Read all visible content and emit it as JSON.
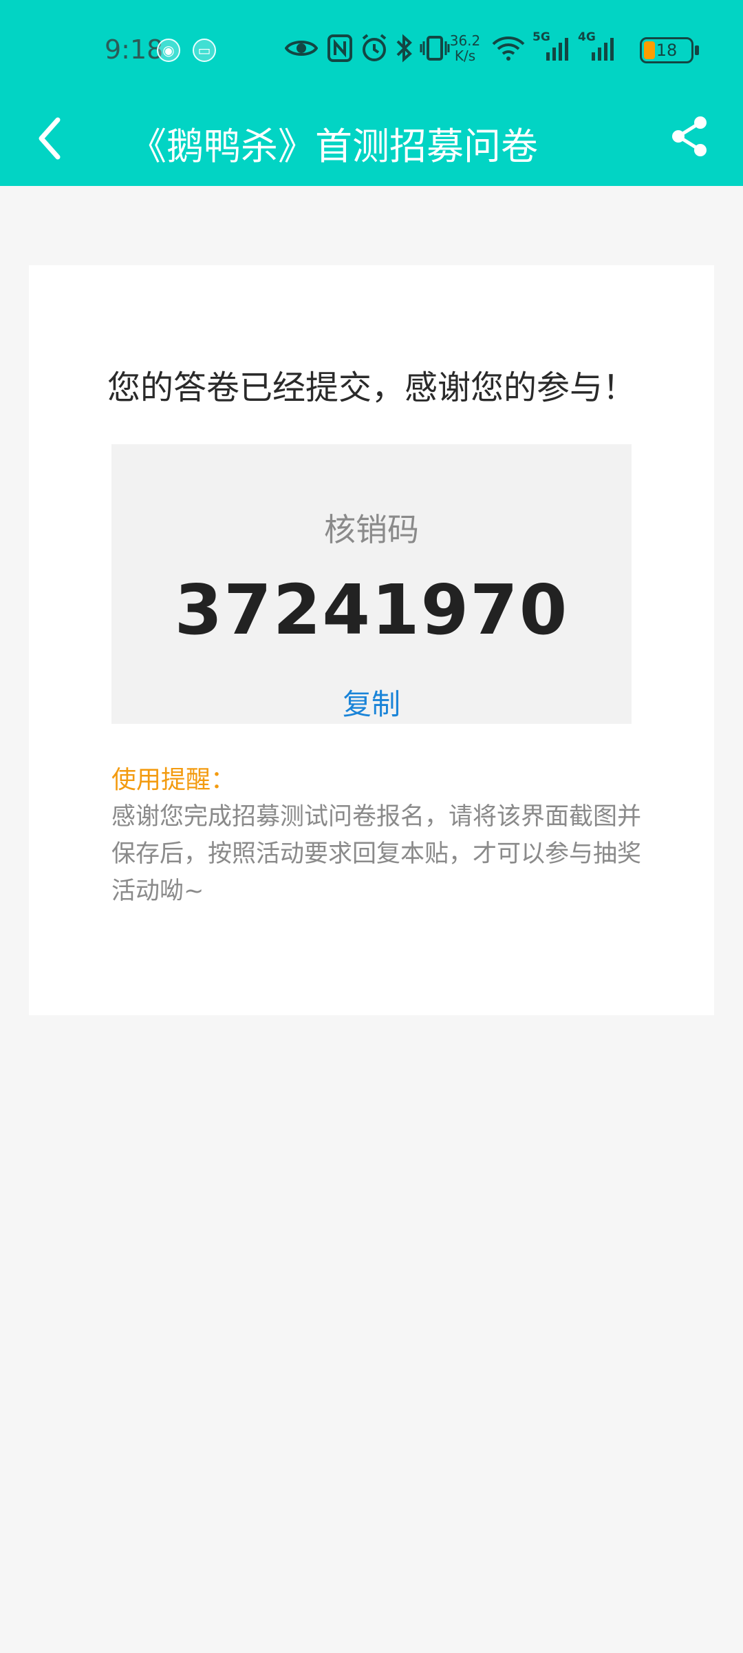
{
  "status_bar": {
    "time": "9:18",
    "notif_icons": [
      "wechat-icon",
      "message-icon"
    ],
    "network_speed_value": "36.2",
    "network_speed_unit": "K/s",
    "net1": "5G",
    "net2": "4G",
    "battery_level": "18"
  },
  "header": {
    "title": "《鹅鸭杀》首测招募问卷",
    "back_icon": "chevron-left-icon",
    "share_icon": "share-icon"
  },
  "card": {
    "headline": "您的答卷已经提交，感谢您的参与！",
    "code_label": "核销码",
    "code_value": "37241970",
    "copy_label": "复制",
    "tip_title": "使用提醒：",
    "tip_text": "感谢您完成招募测试问卷报名，请将该界面截图并保存后，按照活动要求回复本贴，才可以参与抽奖活动呦~"
  },
  "colors": {
    "header_bg": "#02d4c4",
    "page_bg": "#f6f6f6",
    "link_blue": "#1a84d8",
    "tip_orange": "#f39b10",
    "battery_fill": "#ff9d00"
  }
}
